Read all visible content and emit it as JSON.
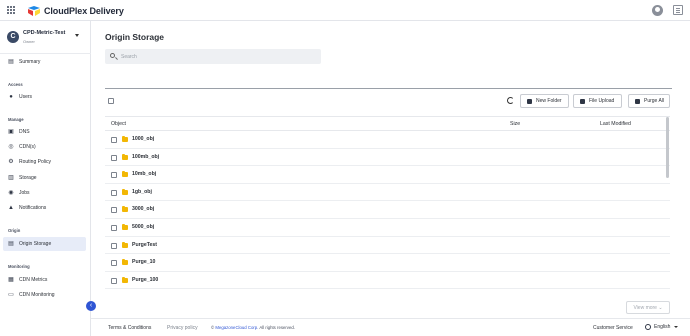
{
  "app": {
    "brand": "CloudPlex Delivery",
    "brand_colors": {
      "primary": "#2f55d4",
      "logo_a": "#1e88e5",
      "logo_b": "#e53935",
      "logo_c": "#fdd835"
    }
  },
  "header": {
    "apps_icon": "grid-icon",
    "account_icon": "user-circle-icon",
    "menu_icon": "menu-icon"
  },
  "account": {
    "initial": "C",
    "name": "CPD-Metric-Test",
    "role": "Owner"
  },
  "sidebar": {
    "summary": {
      "label": "Summary",
      "icon": "document-icon"
    },
    "sections": [
      {
        "title": "Access",
        "items": [
          {
            "label": "Users",
            "icon": "user-icon"
          }
        ]
      },
      {
        "title": "Manage",
        "items": [
          {
            "label": "DNS",
            "icon": "dns-icon"
          },
          {
            "label": "CDN(s)",
            "icon": "cdn-icon"
          },
          {
            "label": "Routing Policy",
            "icon": "routing-icon"
          },
          {
            "label": "Storage",
            "icon": "storage-icon"
          },
          {
            "label": "Jobs",
            "icon": "jobs-icon"
          },
          {
            "label": "Notifications",
            "icon": "bell-icon"
          }
        ]
      },
      {
        "title": "Origin",
        "items": [
          {
            "label": "Origin Storage",
            "icon": "folder-icon",
            "active": true
          }
        ]
      },
      {
        "title": "Monitoring",
        "items": [
          {
            "label": "CDN Metrics",
            "icon": "metrics-icon"
          },
          {
            "label": "CDN Monitoring",
            "icon": "monitor-icon"
          }
        ]
      }
    ],
    "collapse_icon": "chevron-left-icon"
  },
  "main": {
    "title": "Origin Storage",
    "search": {
      "placeholder": "Search",
      "value": ""
    },
    "toolbar": {
      "refresh_icon": "refresh-icon",
      "new_folder": "New Folder",
      "file_upload": "File Upload",
      "purge_all": "Purge All"
    },
    "table": {
      "columns": [
        "Object",
        "Size",
        "Last Modified"
      ],
      "rows": [
        {
          "name": "1000_obj",
          "size": "",
          "modified": ""
        },
        {
          "name": "100mb_obj",
          "size": "",
          "modified": ""
        },
        {
          "name": "10mb_obj",
          "size": "",
          "modified": ""
        },
        {
          "name": "1gb_obj",
          "size": "",
          "modified": ""
        },
        {
          "name": "3000_obj",
          "size": "",
          "modified": ""
        },
        {
          "name": "5000_obj",
          "size": "",
          "modified": ""
        },
        {
          "name": "PurgeTest",
          "size": "",
          "modified": ""
        },
        {
          "name": "Purge_10",
          "size": "",
          "modified": ""
        },
        {
          "name": "Purge_100",
          "size": "",
          "modified": ""
        }
      ]
    },
    "view_more": "View more"
  },
  "footer": {
    "terms": "Terms & Conditions",
    "privacy": "Privacy policy",
    "copyright_prefix": "©",
    "copyright_company": "MegazoneCloud Corp.",
    "copyright_suffix": "All rights reserved.",
    "customer_service": "Customer Service",
    "language": "English"
  }
}
